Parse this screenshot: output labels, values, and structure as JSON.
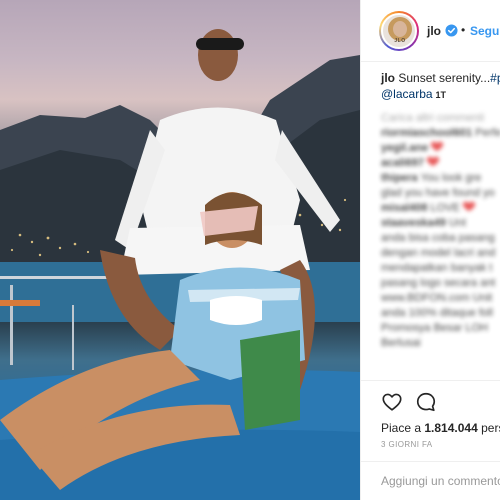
{
  "post": {
    "username": "jlo",
    "follow_separator": "•",
    "follow_label": "Segui",
    "avatar_label": "JLO",
    "caption": {
      "username": "jlo",
      "text": "Sunset serenity...",
      "hashtag": "#p",
      "mention": "@lacarba",
      "edited_time": "1T"
    },
    "comments": [
      {
        "user": "Carica altri commenti",
        "text": "",
        "muted": true
      },
      {
        "user": "riormiaschool601",
        "text": "Perfe"
      },
      {
        "user": "yegil.ane",
        "text": "",
        "emoji": "heart"
      },
      {
        "user": "acali697",
        "text": "",
        "emoji": "heart"
      },
      {
        "user": "thipera",
        "text": "You look gre"
      },
      {
        "user": "",
        "text": "glad you have found yo"
      },
      {
        "user": "misal408",
        "text": "LOVE",
        "emoji": "heart"
      },
      {
        "user": "staaveska49",
        "text": "Unt"
      },
      {
        "user": "",
        "text": "anda bisa coba pasang"
      },
      {
        "user": "",
        "text": "dengan model lacri and"
      },
      {
        "user": "",
        "text": "mendapatkan banyak t"
      },
      {
        "user": "",
        "text": "pasang logo secara ant"
      },
      {
        "user": "",
        "text": "www.BDFON.com Unit"
      },
      {
        "user": "",
        "text": "anda 100% ditaque foll"
      },
      {
        "user": "",
        "text": "Promosya Besar LOH"
      },
      {
        "user": "",
        "text": "Berlusai"
      }
    ],
    "likes_prefix": "Piace a",
    "likes_count": "1.814.044",
    "likes_suffix": "perso",
    "time_ago": "3 GIORNI FA",
    "comment_placeholder": "Aggiungi un commento..."
  },
  "colors": {
    "link_blue": "#3897f0",
    "verified_blue": "#3897f0",
    "text": "#262626",
    "muted": "#999999",
    "border": "#efefef"
  },
  "icons": [
    "verified-badge-icon",
    "heart-outline-icon",
    "comment-bubble-icon"
  ]
}
